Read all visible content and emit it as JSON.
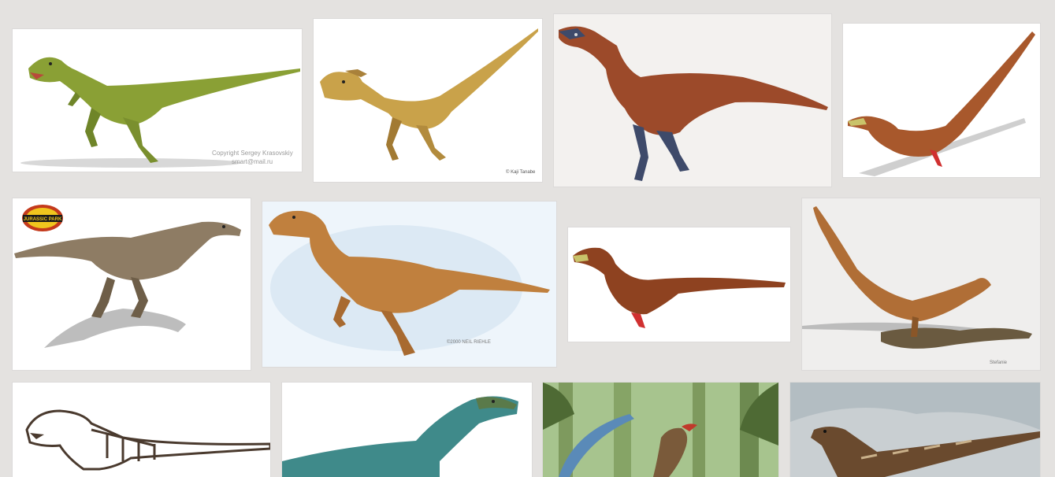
{
  "gallery": {
    "tiles": [
      {
        "subject": "green raptor",
        "credit": "Copyright Sergey Krasovskiy",
        "credit2": "smart@mail.ru"
      },
      {
        "subject": "yellow raptor",
        "credit": "© Kaji Tanabe"
      },
      {
        "subject": "red feathered raptor"
      },
      {
        "subject": "feathered raptor"
      },
      {
        "subject": "jurassic park raptor",
        "logo_text": "JURASSIC PARK"
      },
      {
        "subject": "brown raptor",
        "credit": "©2000 NEIL RIEHLE"
      },
      {
        "subject": "feathered raptor small"
      },
      {
        "subject": "feathered raptor with prey",
        "credit": "Stefanie"
      },
      {
        "subject": "raptor skeleton"
      },
      {
        "subject": "teal raptor"
      },
      {
        "subject": "jungle feathered raptor"
      },
      {
        "subject": "striped raptor sky"
      }
    ]
  }
}
